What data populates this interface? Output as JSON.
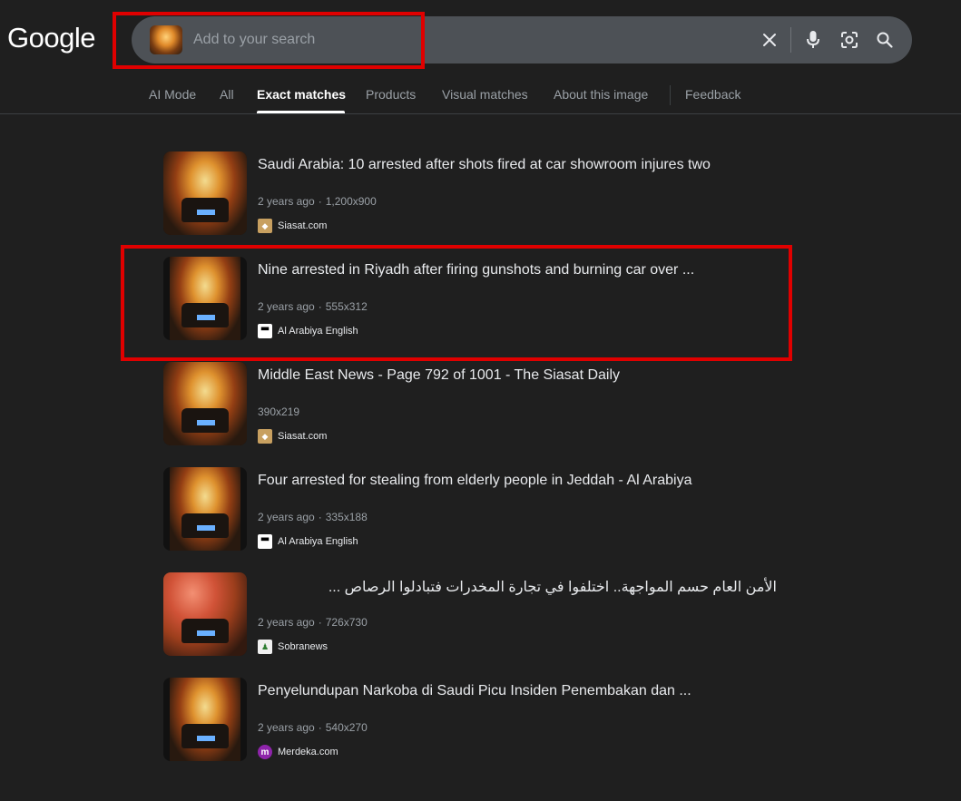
{
  "header": {
    "logo": "Google",
    "search": {
      "placeholder": "Add to your search",
      "value": ""
    },
    "icons": [
      "close-icon",
      "mic-icon",
      "lens-icon",
      "search-icon"
    ]
  },
  "tabs": [
    {
      "label": "AI Mode",
      "active": false
    },
    {
      "label": "All",
      "active": false
    },
    {
      "label": "Exact matches",
      "active": true
    },
    {
      "label": "Products",
      "active": false
    },
    {
      "label": "Visual matches",
      "active": false
    },
    {
      "label": "About this image",
      "active": false
    },
    {
      "label": "Feedback",
      "active": false
    }
  ],
  "results": [
    {
      "title": "Saudi Arabia: 10 arrested after shots fired at car showroom injures two",
      "age": "2 years ago",
      "size": "1,200x900",
      "source": "Siasat.com"
    },
    {
      "title": "Nine arrested in Riyadh after firing gunshots and burning car over ...",
      "age": "2 years ago",
      "size": "555x312",
      "source": "Al Arabiya English"
    },
    {
      "title": "Middle East News - Page 792 of 1001 - The Siasat Daily",
      "age": "",
      "size": "390x219",
      "source": "Siasat.com"
    },
    {
      "title": "Four arrested for stealing from elderly people in Jeddah - Al Arabiya",
      "age": "2 years ago",
      "size": "335x188",
      "source": "Al Arabiya English"
    },
    {
      "title": "الأمن العام حسم المواجهة.. اختلفوا في تجارة المخدرات فتبادلوا الرصاص ...",
      "age": "2 years ago",
      "size": "726x730",
      "source": "Sobranews"
    },
    {
      "title": "Penyelundupan Narkoba di Saudi Picu Insiden Penembakan dan ...",
      "age": "2 years ago",
      "size": "540x270",
      "source": "Merdeka.com"
    }
  ],
  "colors": {
    "background": "#1f1f1f",
    "searchbar": "#4d5156",
    "highlight": "#e00000"
  }
}
